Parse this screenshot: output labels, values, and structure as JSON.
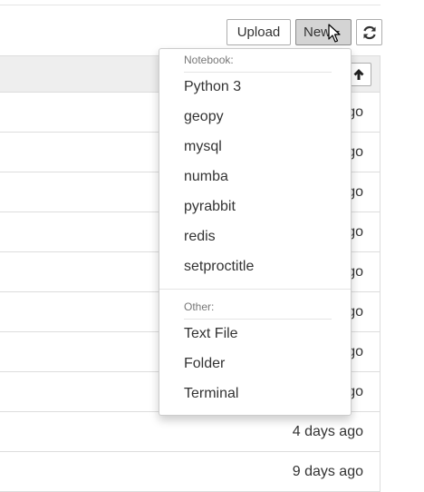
{
  "toolbar": {
    "upload_label": "Upload",
    "new_label": "New",
    "refresh_icon": "refresh-icon"
  },
  "file_list": {
    "sort_icon": "arrow-up-icon",
    "rows": [
      {
        "modified": "go"
      },
      {
        "modified": "go"
      },
      {
        "modified": "go"
      },
      {
        "modified": "go"
      },
      {
        "modified": "go"
      },
      {
        "modified": "go"
      },
      {
        "modified": "go"
      },
      {
        "modified": "go"
      },
      {
        "modified": "4 days ago"
      },
      {
        "modified": "9 days ago"
      }
    ]
  },
  "new_menu": {
    "notebook_header": "Notebook:",
    "notebook_items": [
      "Python 3",
      "geopy",
      "mysql",
      "numba",
      "pyrabbit",
      "redis",
      "setproctitle"
    ],
    "other_header": "Other:",
    "other_items": [
      "Text File",
      "Folder",
      "Terminal"
    ]
  }
}
